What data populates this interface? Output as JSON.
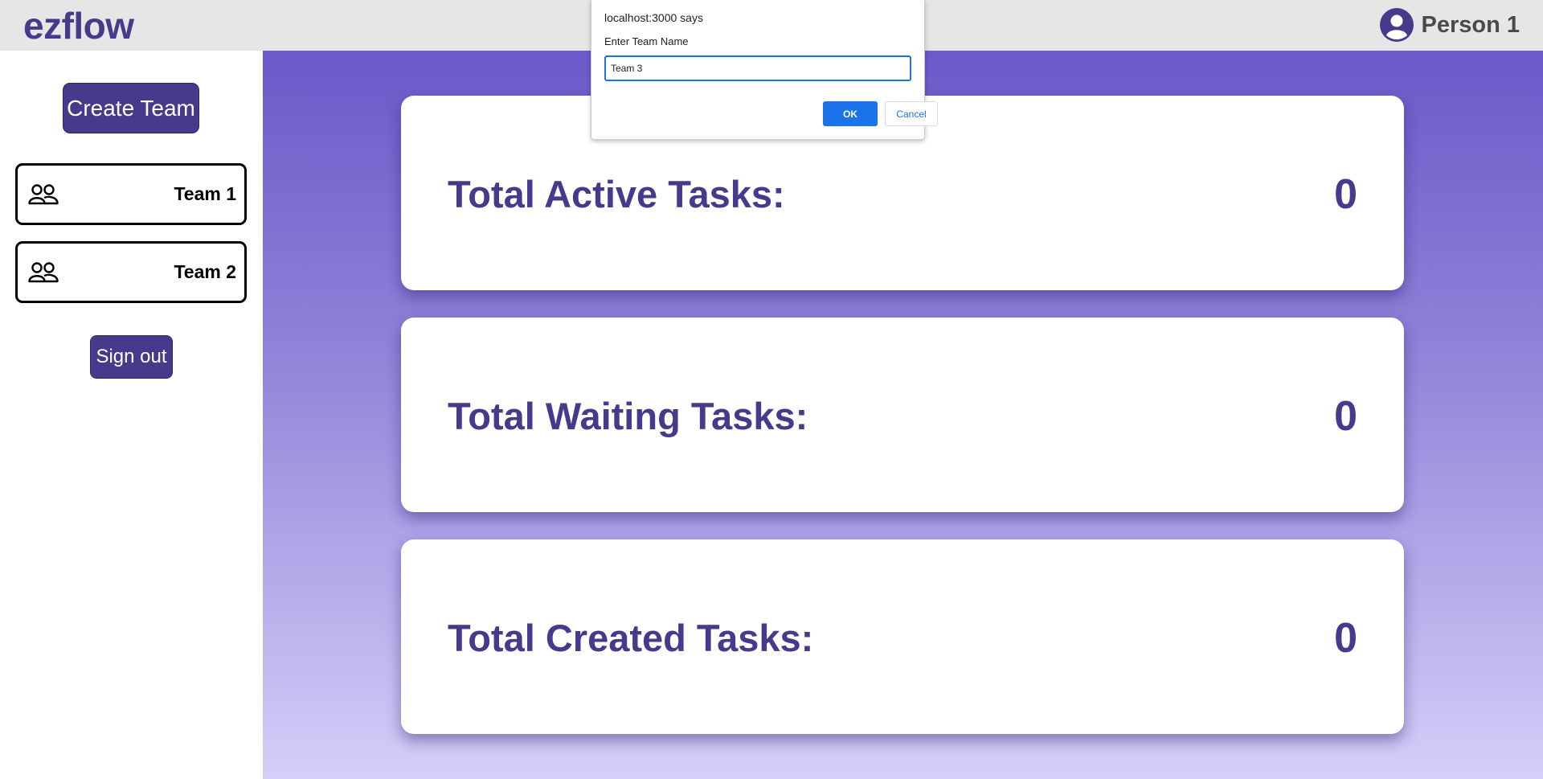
{
  "header": {
    "logo": "ezflow",
    "user_name": "Person 1",
    "avatar_icon": "user-circle-icon"
  },
  "sidebar": {
    "create_team_label": "Create Team",
    "teams": [
      {
        "label": "Team 1",
        "icon": "team-icon"
      },
      {
        "label": "Team 2",
        "icon": "team-icon"
      }
    ],
    "sign_out_label": "Sign out"
  },
  "stats": [
    {
      "label": "Total Active Tasks:",
      "value": "0"
    },
    {
      "label": "Total Waiting Tasks:",
      "value": "0"
    },
    {
      "label": "Total Created Tasks:",
      "value": "0"
    }
  ],
  "dialog": {
    "title": "localhost:3000 says",
    "message": "Enter Team Name",
    "input_value": "Team 3",
    "ok_label": "OK",
    "cancel_label": "Cancel"
  },
  "colors": {
    "brand": "#463a8c",
    "header_bg": "#e6e6e6",
    "gradient_top": "#6a59c9",
    "gradient_bottom": "#d5cef8",
    "dialog_accent": "#1a73e8"
  }
}
